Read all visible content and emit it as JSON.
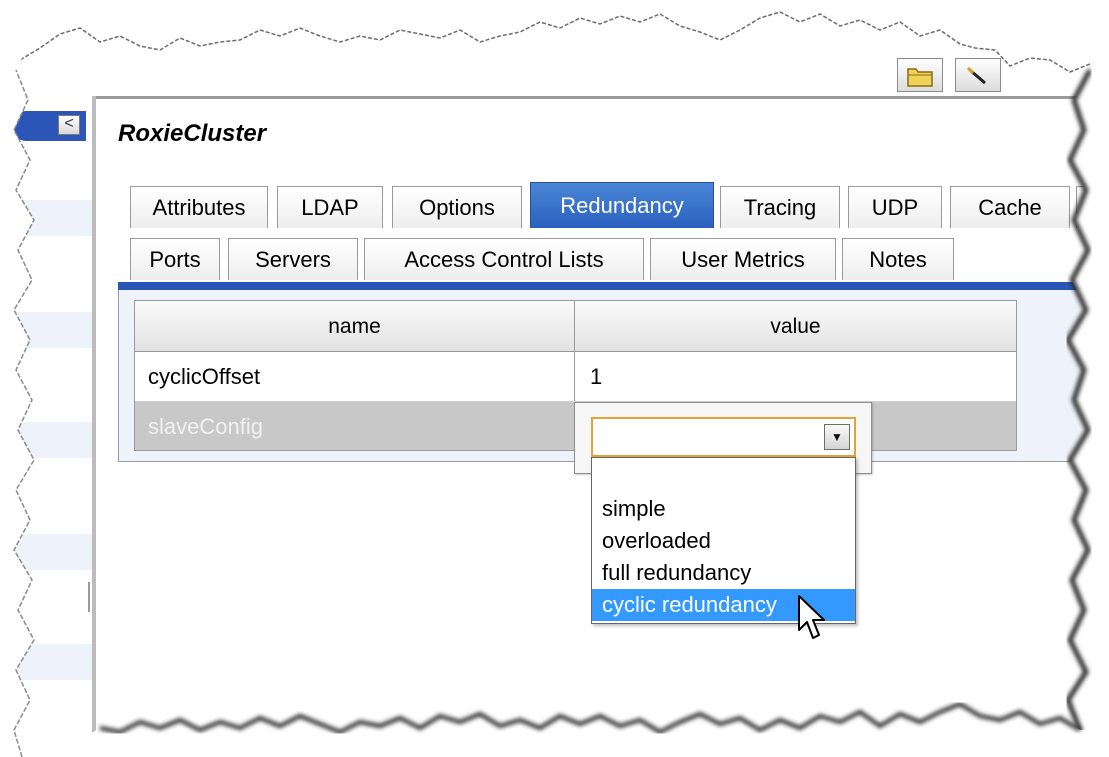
{
  "window": {
    "title": "RoxieCluster"
  },
  "toolbar": {
    "open_icon": "folder-icon",
    "tool_icon": "wand-icon"
  },
  "dock": {
    "collapse_glyph": "<",
    "collapse_icon": "chevron-left-icon"
  },
  "tabs": {
    "row1": [
      {
        "label": "Attributes",
        "active": false
      },
      {
        "label": "LDAP",
        "active": false
      },
      {
        "label": "Options",
        "active": false
      },
      {
        "label": "Redundancy",
        "active": true
      },
      {
        "label": "Tracing",
        "active": false
      },
      {
        "label": "UDP",
        "active": false
      },
      {
        "label": "Cache",
        "active": false
      }
    ],
    "row2": [
      {
        "label": "Ports"
      },
      {
        "label": "Servers"
      },
      {
        "label": "Access Control Lists"
      },
      {
        "label": "User Metrics"
      },
      {
        "label": "Notes"
      }
    ]
  },
  "grid": {
    "columns": [
      "name",
      "value"
    ],
    "rows": [
      {
        "name": "cyclicOffset",
        "value": "1",
        "selected": false
      },
      {
        "name": "slaveConfig",
        "value": "",
        "selected": true
      }
    ]
  },
  "editor": {
    "value": "",
    "arrow_icon": "dropdown-arrow-icon",
    "options": [
      "",
      "simple",
      "overloaded",
      "full redundancy",
      "cyclic redundancy"
    ],
    "highlighted_index": 4
  },
  "colors": {
    "active_tab": "#2b60bf",
    "tab_strip": "#2b55b5",
    "highlight": "#3399ff",
    "focus_border": "#e2a33a",
    "selected_row": "#c8c8c8"
  }
}
